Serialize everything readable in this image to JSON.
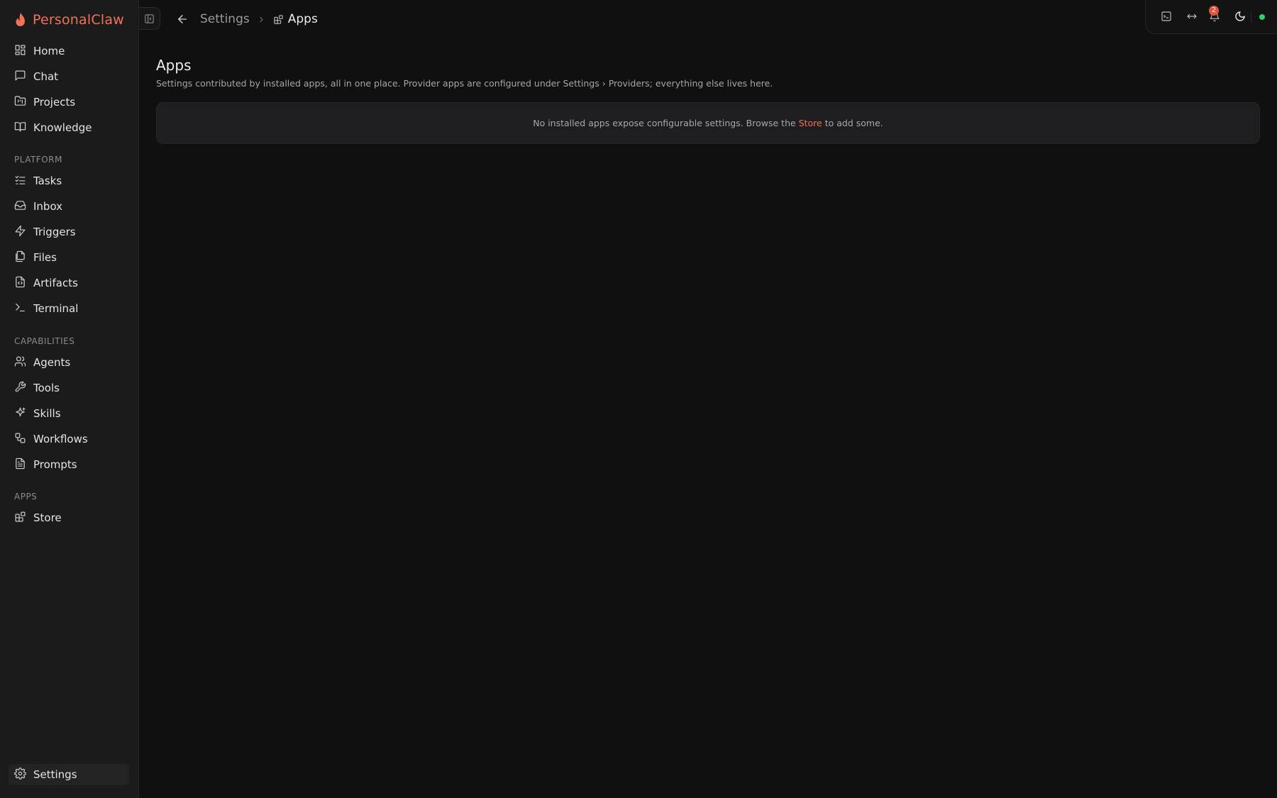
{
  "app": {
    "name": "PersonalClaw",
    "accent_color": "#f07356"
  },
  "sidebar": {
    "main_items": [
      {
        "label": "Home",
        "icon": "layout-dashboard-icon"
      },
      {
        "label": "Chat",
        "icon": "message-square-icon"
      },
      {
        "label": "Projects",
        "icon": "folder-kanban-icon"
      },
      {
        "label": "Knowledge",
        "icon": "book-open-icon"
      }
    ],
    "sections": {
      "platform": {
        "label": "PLATFORM",
        "items": [
          {
            "label": "Tasks",
            "icon": "list-checks-icon"
          },
          {
            "label": "Inbox",
            "icon": "inbox-icon"
          },
          {
            "label": "Triggers",
            "icon": "zap-icon"
          },
          {
            "label": "Files",
            "icon": "files-icon"
          },
          {
            "label": "Artifacts",
            "icon": "file-code-icon"
          },
          {
            "label": "Terminal",
            "icon": "terminal-icon"
          }
        ]
      },
      "capabilities": {
        "label": "CAPABILITIES",
        "items": [
          {
            "label": "Agents",
            "icon": "users-icon"
          },
          {
            "label": "Tools",
            "icon": "wrench-icon"
          },
          {
            "label": "Skills",
            "icon": "sparkles-icon"
          },
          {
            "label": "Workflows",
            "icon": "workflow-icon"
          },
          {
            "label": "Prompts",
            "icon": "file-text-icon"
          }
        ]
      },
      "apps": {
        "label": "APPS",
        "items": [
          {
            "label": "Store",
            "icon": "blocks-icon"
          }
        ]
      }
    },
    "footer_item": {
      "label": "Settings",
      "icon": "gear-icon",
      "active": true
    }
  },
  "breadcrumb": {
    "parent": "Settings",
    "current": "Apps",
    "current_icon": "blocks-icon"
  },
  "top_right": {
    "icons": [
      "terminal-panel-icon",
      "arrows-horizontal-icon",
      "bell-icon",
      "moon-icon"
    ],
    "notification_count": "2",
    "status_color": "#2fcf6b"
  },
  "main": {
    "title": "Apps",
    "description": "Settings contributed by installed apps, all in one place. Provider apps are configured under Settings › Providers; everything else lives here.",
    "empty_state": {
      "before": "No installed apps expose configurable settings. Browse the",
      "link": "Store",
      "after": "to add some."
    }
  }
}
